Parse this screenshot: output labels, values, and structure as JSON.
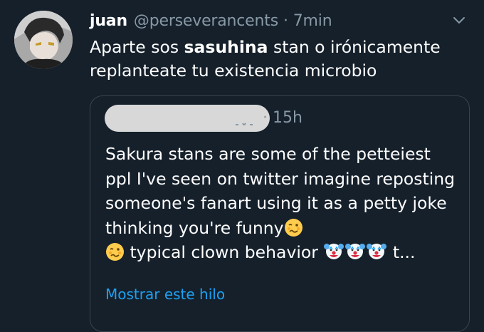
{
  "tweet": {
    "author_name": "juan",
    "author_handle": "@perseverancents",
    "separator": "·",
    "time": "7min",
    "text_part1": "Aparte sos ",
    "text_bold": "sasuhina",
    "text_part2": " stan  o irónicamente replanteate tu existencia microbio",
    "avatar_icon": "anime-avatar-icon",
    "menu_icon": "chevron-down-icon"
  },
  "quoted_tweet": {
    "author_redacted": true,
    "separator": "·",
    "time": "15h",
    "text_main": "Sakura stans are some of the petteiest ppl I've seen on twitter imagine reposting someone's fanart using it as a petty joke thinking you're funny",
    "text_tail_1": " typical clown behavior ",
    "text_ellipsis": " t...",
    "emojis": [
      "woozy-face-emoji",
      "woozy-face-emoji",
      "clown-face-emoji",
      "clown-face-emoji",
      "clown-face-emoji"
    ],
    "show_thread": "Mostrar este hilo"
  },
  "colors": {
    "background": "#15202b",
    "secondary_text": "#8899a6",
    "link": "#1da1f2",
    "border": "#38444d"
  }
}
